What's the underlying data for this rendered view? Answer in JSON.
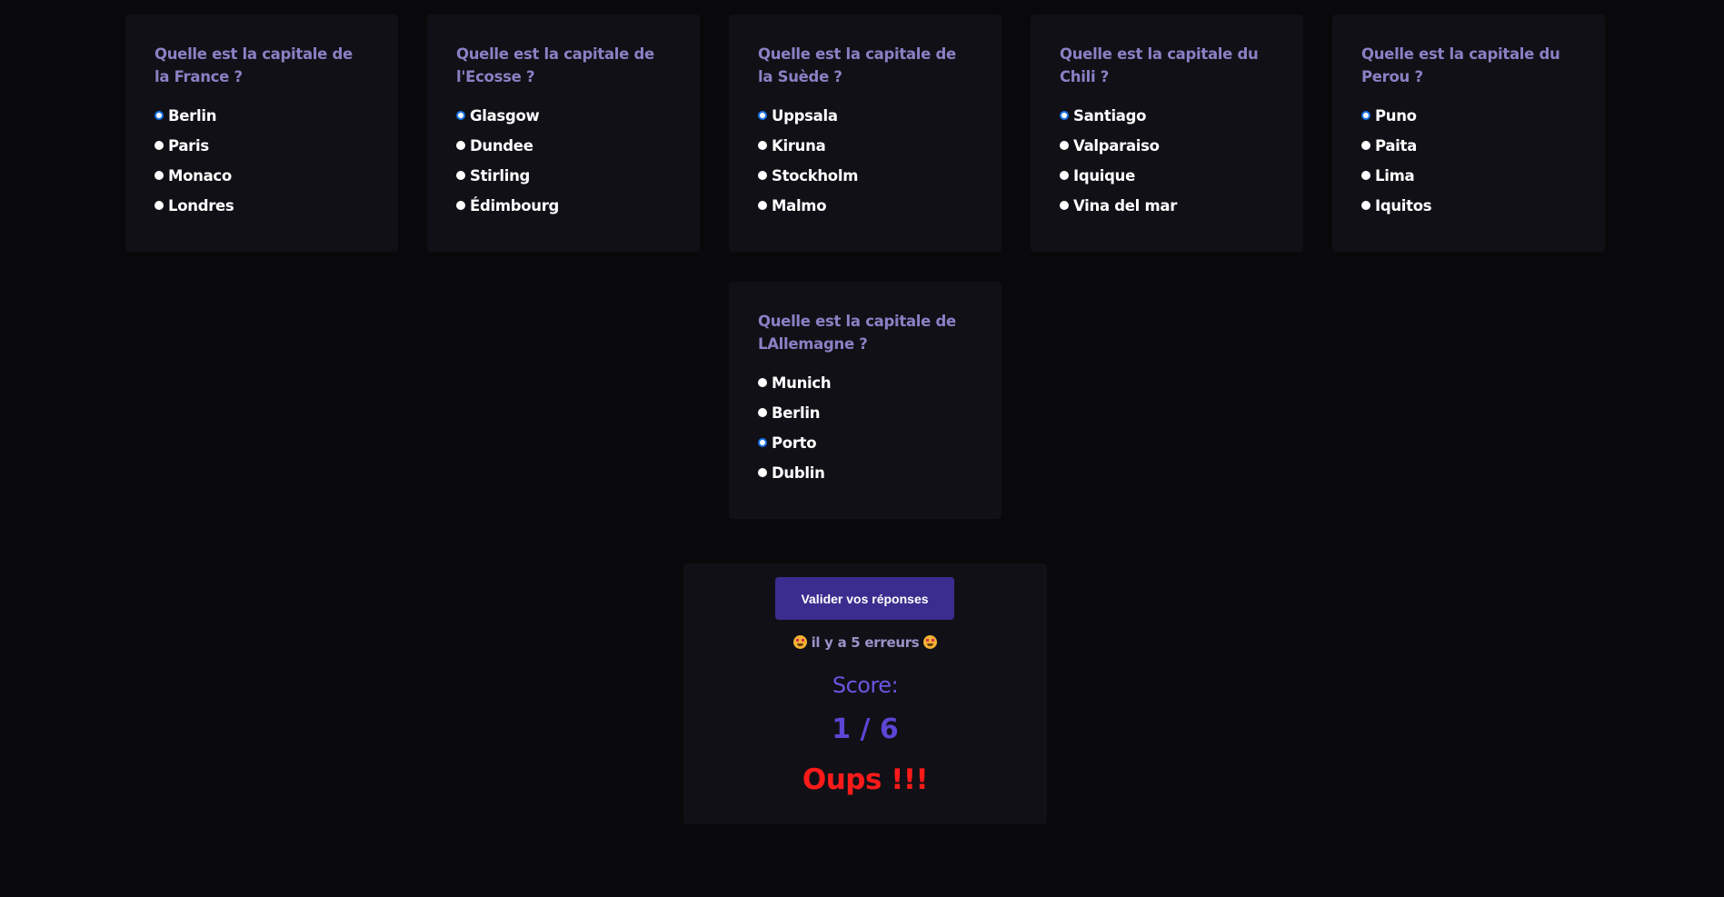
{
  "questions": [
    {
      "title": "Quelle est la capitale de la France ?",
      "options": [
        {
          "label": "Berlin",
          "checked": true
        },
        {
          "label": "Paris",
          "checked": false
        },
        {
          "label": "Monaco",
          "checked": false
        },
        {
          "label": "Londres",
          "checked": false
        }
      ]
    },
    {
      "title": "Quelle est la capitale de l'Ecosse ?",
      "options": [
        {
          "label": "Glasgow",
          "checked": true
        },
        {
          "label": "Dundee",
          "checked": false
        },
        {
          "label": "Stirling",
          "checked": false
        },
        {
          "label": "Édimbourg",
          "checked": false
        }
      ]
    },
    {
      "title": "Quelle est la capitale de la Suède ?",
      "options": [
        {
          "label": "Uppsala",
          "checked": true
        },
        {
          "label": "Kiruna",
          "checked": false
        },
        {
          "label": "Stockholm",
          "checked": false
        },
        {
          "label": "Malmo",
          "checked": false
        }
      ]
    },
    {
      "title": "Quelle est la capitale du Chili ?",
      "options": [
        {
          "label": "Santiago",
          "checked": true
        },
        {
          "label": "Valparaiso",
          "checked": false
        },
        {
          "label": "Iquique",
          "checked": false
        },
        {
          "label": "Vina del mar",
          "checked": false
        }
      ]
    },
    {
      "title": "Quelle est la capitale du Perou ?",
      "options": [
        {
          "label": "Puno",
          "checked": true
        },
        {
          "label": "Paita",
          "checked": false
        },
        {
          "label": "Lima",
          "checked": false
        },
        {
          "label": "Iquitos",
          "checked": false
        }
      ]
    },
    {
      "title": "Quelle est la capitale de LAllemagne ?",
      "options": [
        {
          "label": "Munich",
          "checked": false
        },
        {
          "label": "Berlin",
          "checked": false
        },
        {
          "label": "Porto",
          "checked": true
        },
        {
          "label": "Dublin",
          "checked": false
        }
      ]
    }
  ],
  "result": {
    "validate_label": "Valider vos réponses",
    "errors_text": "il y a 5 erreurs",
    "errors_icon": "star-struck-emoji-icon",
    "score_label": "Score:",
    "score_value": "1 / 6",
    "verdict": "Oups !!!"
  },
  "colors": {
    "background": "#09090b",
    "card": "#101016",
    "question_text": "#8a80c4",
    "button": "#3b2d8f",
    "score": "#5e45d4",
    "verdict": "#ff1a1a",
    "radio_checked": "#1a73e8"
  }
}
